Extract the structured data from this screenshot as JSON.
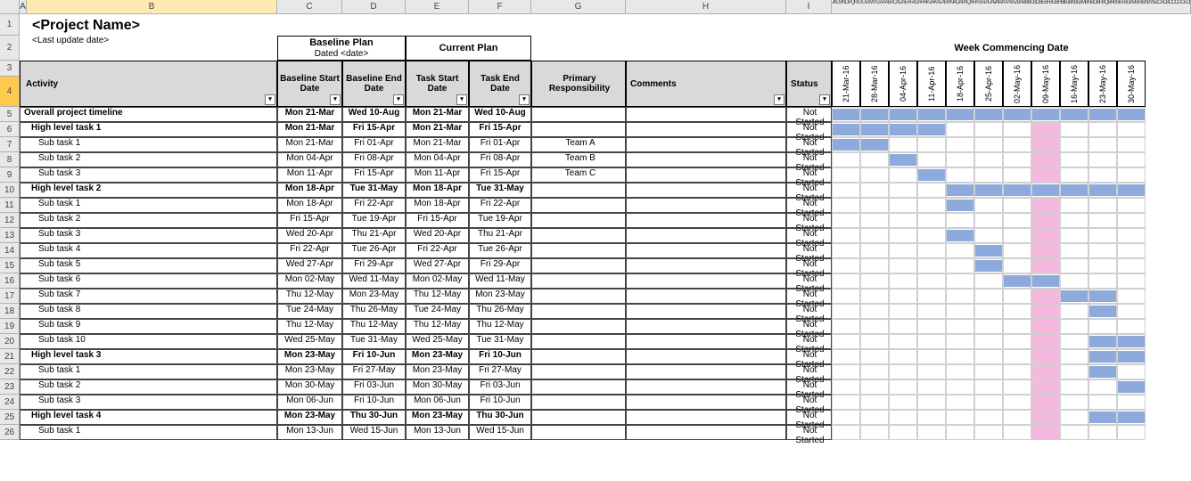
{
  "project": {
    "title": "<Project Name>",
    "subtitle": "<Last update date>"
  },
  "headers": {
    "baseline_plan": "Baseline Plan",
    "baseline_dated": "Dated <date>",
    "current_plan": "Current Plan",
    "week_commencing": "Week Commencing Date",
    "activity": "Activity",
    "baseline_start": "Baseline Start Date",
    "baseline_end": "Baseline End Date",
    "task_start": "Task Start Date",
    "task_end": "Task End Date",
    "primary_resp": "Primary Responsibility",
    "comments": "Comments",
    "status": "Status"
  },
  "column_letters": [
    "A",
    "B",
    "C",
    "D",
    "E",
    "F",
    "G",
    "H",
    "I"
  ],
  "tiny_cols": "JKLMNOPQRSTUVWXYZAAABACADAEAFAGAHAIAJAKALAMANAOAPAQARASATAUAVAWAXAYAZBABBBCBDBEBFBGBHBIBJBKBLBMBNBOBPBQBRBSBTBUBVBWBXBYBZCACBCCCDCECFCGCHCICJCKCLCMCNCO",
  "weeks": [
    "21-Mar-16",
    "28-Mar-16",
    "04-Apr-16",
    "11-Apr-16",
    "18-Apr-16",
    "25-Apr-16",
    "02-May-16",
    "09-May-16",
    "16-May-16",
    "23-May-16",
    "30-May-16"
  ],
  "pink_week_index": 7,
  "status_default": "Not Started",
  "rows": [
    {
      "n": 5,
      "act": "Overall project timeline",
      "lvl": 0,
      "bs": "Mon 21-Mar",
      "be": "Wed 10-Aug",
      "ts": "Mon 21-Mar",
      "te": "Wed 10-Aug",
      "resp": "",
      "cmt": "",
      "st": "Not Started",
      "bars": [
        0,
        1,
        2,
        3,
        4,
        5,
        6,
        7,
        8,
        9,
        10
      ],
      "bold": true
    },
    {
      "n": 6,
      "act": "High level task 1",
      "lvl": 1,
      "bs": "Mon 21-Mar",
      "be": "Fri 15-Apr",
      "ts": "Mon 21-Mar",
      "te": "Fri 15-Apr",
      "resp": "",
      "cmt": "",
      "st": "Not Started",
      "bars": [
        0,
        1,
        2,
        3
      ],
      "bold": true
    },
    {
      "n": 7,
      "act": "Sub task 1",
      "lvl": 2,
      "bs": "Mon 21-Mar",
      "be": "Fri 01-Apr",
      "ts": "Mon 21-Mar",
      "te": "Fri 01-Apr",
      "resp": "Team A",
      "cmt": "",
      "st": "Not Started",
      "bars": [
        0,
        1
      ],
      "bold": false
    },
    {
      "n": 8,
      "act": "Sub task 2",
      "lvl": 2,
      "bs": "Mon 04-Apr",
      "be": "Fri 08-Apr",
      "ts": "Mon 04-Apr",
      "te": "Fri 08-Apr",
      "resp": "Team B",
      "cmt": "",
      "st": "Not Started",
      "bars": [
        2
      ],
      "bold": false
    },
    {
      "n": 9,
      "act": "Sub task 3",
      "lvl": 2,
      "bs": "Mon 11-Apr",
      "be": "Fri 15-Apr",
      "ts": "Mon 11-Apr",
      "te": "Fri 15-Apr",
      "resp": "Team C",
      "cmt": "",
      "st": "Not Started",
      "bars": [
        3
      ],
      "bold": false
    },
    {
      "n": 10,
      "act": "High level task 2",
      "lvl": 1,
      "bs": "Mon 18-Apr",
      "be": "Tue 31-May",
      "ts": "Mon 18-Apr",
      "te": "Tue 31-May",
      "resp": "",
      "cmt": "",
      "st": "Not Started",
      "bars": [
        4,
        5,
        6,
        7,
        8,
        9,
        10
      ],
      "bold": true
    },
    {
      "n": 11,
      "act": "Sub task 1",
      "lvl": 2,
      "bs": "Mon 18-Apr",
      "be": "Fri 22-Apr",
      "ts": "Mon 18-Apr",
      "te": "Fri 22-Apr",
      "resp": "",
      "cmt": "",
      "st": "Not Started",
      "bars": [
        4
      ],
      "bold": false
    },
    {
      "n": 12,
      "act": "Sub task 2",
      "lvl": 2,
      "bs": "Fri 15-Apr",
      "be": "Tue 19-Apr",
      "ts": "Fri 15-Apr",
      "te": "Tue 19-Apr",
      "resp": "",
      "cmt": "",
      "st": "Not Started",
      "bars": [],
      "bold": false
    },
    {
      "n": 13,
      "act": "Sub task 3",
      "lvl": 2,
      "bs": "Wed 20-Apr",
      "be": "Thu 21-Apr",
      "ts": "Wed 20-Apr",
      "te": "Thu 21-Apr",
      "resp": "",
      "cmt": "",
      "st": "Not Started",
      "bars": [
        4
      ],
      "bold": false
    },
    {
      "n": 14,
      "act": "Sub task 4",
      "lvl": 2,
      "bs": "Fri 22-Apr",
      "be": "Tue 26-Apr",
      "ts": "Fri 22-Apr",
      "te": "Tue 26-Apr",
      "resp": "",
      "cmt": "",
      "st": "Not Started",
      "bars": [
        5
      ],
      "bold": false
    },
    {
      "n": 15,
      "act": "Sub task 5",
      "lvl": 2,
      "bs": "Wed 27-Apr",
      "be": "Fri 29-Apr",
      "ts": "Wed 27-Apr",
      "te": "Fri 29-Apr",
      "resp": "",
      "cmt": "",
      "st": "Not Started",
      "bars": [
        5
      ],
      "bold": false
    },
    {
      "n": 16,
      "act": "Sub task 6",
      "lvl": 2,
      "bs": "Mon 02-May",
      "be": "Wed 11-May",
      "ts": "Mon 02-May",
      "te": "Wed 11-May",
      "resp": "",
      "cmt": "",
      "st": "Not Started",
      "bars": [
        6,
        7
      ],
      "bold": false
    },
    {
      "n": 17,
      "act": "Sub task 7",
      "lvl": 2,
      "bs": "Thu 12-May",
      "be": "Mon 23-May",
      "ts": "Thu 12-May",
      "te": "Mon 23-May",
      "resp": "",
      "cmt": "",
      "st": "Not Started",
      "bars": [
        8,
        9
      ],
      "bold": false
    },
    {
      "n": 18,
      "act": "Sub task 8",
      "lvl": 2,
      "bs": "Tue 24-May",
      "be": "Thu 26-May",
      "ts": "Tue 24-May",
      "te": "Thu 26-May",
      "resp": "",
      "cmt": "",
      "st": "Not Started",
      "bars": [
        9
      ],
      "bold": false
    },
    {
      "n": 19,
      "act": "Sub task 9",
      "lvl": 2,
      "bs": "Thu 12-May",
      "be": "Thu 12-May",
      "ts": "Thu 12-May",
      "te": "Thu 12-May",
      "resp": "",
      "cmt": "",
      "st": "Not Started",
      "bars": [],
      "bold": false
    },
    {
      "n": 20,
      "act": "Sub task 10",
      "lvl": 2,
      "bs": "Wed 25-May",
      "be": "Tue 31-May",
      "ts": "Wed 25-May",
      "te": "Tue 31-May",
      "resp": "",
      "cmt": "",
      "st": "Not Started",
      "bars": [
        9,
        10
      ],
      "bold": false
    },
    {
      "n": 21,
      "act": "High level task 3",
      "lvl": 1,
      "bs": "Mon 23-May",
      "be": "Fri 10-Jun",
      "ts": "Mon 23-May",
      "te": "Fri 10-Jun",
      "resp": "",
      "cmt": "",
      "st": "Not Started",
      "bars": [
        9,
        10
      ],
      "bold": true
    },
    {
      "n": 22,
      "act": "Sub task 1",
      "lvl": 2,
      "bs": "Mon 23-May",
      "be": "Fri 27-May",
      "ts": "Mon 23-May",
      "te": "Fri 27-May",
      "resp": "",
      "cmt": "",
      "st": "Not Started",
      "bars": [
        9
      ],
      "bold": false
    },
    {
      "n": 23,
      "act": "Sub task 2",
      "lvl": 2,
      "bs": "Mon 30-May",
      "be": "Fri 03-Jun",
      "ts": "Mon 30-May",
      "te": "Fri 03-Jun",
      "resp": "",
      "cmt": "",
      "st": "Not Started",
      "bars": [
        10
      ],
      "bold": false
    },
    {
      "n": 24,
      "act": "Sub task 3",
      "lvl": 2,
      "bs": "Mon 06-Jun",
      "be": "Fri 10-Jun",
      "ts": "Mon 06-Jun",
      "te": "Fri 10-Jun",
      "resp": "",
      "cmt": "",
      "st": "Not Started",
      "bars": [],
      "bold": false
    },
    {
      "n": 25,
      "act": "High level task 4",
      "lvl": 1,
      "bs": "Mon 23-May",
      "be": "Thu 30-Jun",
      "ts": "Mon 23-May",
      "te": "Thu 30-Jun",
      "resp": "",
      "cmt": "",
      "st": "Not Started",
      "bars": [
        9,
        10
      ],
      "bold": true
    },
    {
      "n": 26,
      "act": "Sub task 1",
      "lvl": 2,
      "bs": "Mon 13-Jun",
      "be": "Wed 15-Jun",
      "ts": "Mon 13-Jun",
      "te": "Wed 15-Jun",
      "resp": "",
      "cmt": "",
      "st": "Not Started",
      "bars": [],
      "bold": false
    }
  ],
  "chart_data": {
    "type": "gantt",
    "x_axis": "Week Commencing Date",
    "categories": [
      "21-Mar-16",
      "28-Mar-16",
      "04-Apr-16",
      "11-Apr-16",
      "18-Apr-16",
      "25-Apr-16",
      "02-May-16",
      "09-May-16",
      "16-May-16",
      "23-May-16",
      "30-May-16"
    ],
    "tasks": [
      {
        "name": "Overall project timeline",
        "start": "21-Mar-16",
        "end": "10-Aug-16"
      },
      {
        "name": "High level task 1",
        "start": "21-Mar-16",
        "end": "15-Apr-16"
      },
      {
        "name": "Sub task 1",
        "start": "21-Mar-16",
        "end": "01-Apr-16"
      },
      {
        "name": "Sub task 2",
        "start": "04-Apr-16",
        "end": "08-Apr-16"
      },
      {
        "name": "Sub task 3",
        "start": "11-Apr-16",
        "end": "15-Apr-16"
      },
      {
        "name": "High level task 2",
        "start": "18-Apr-16",
        "end": "31-May-16"
      },
      {
        "name": "High level task 3",
        "start": "23-May-16",
        "end": "10-Jun-16"
      },
      {
        "name": "High level task 4",
        "start": "23-May-16",
        "end": "30-Jun-16"
      }
    ]
  }
}
